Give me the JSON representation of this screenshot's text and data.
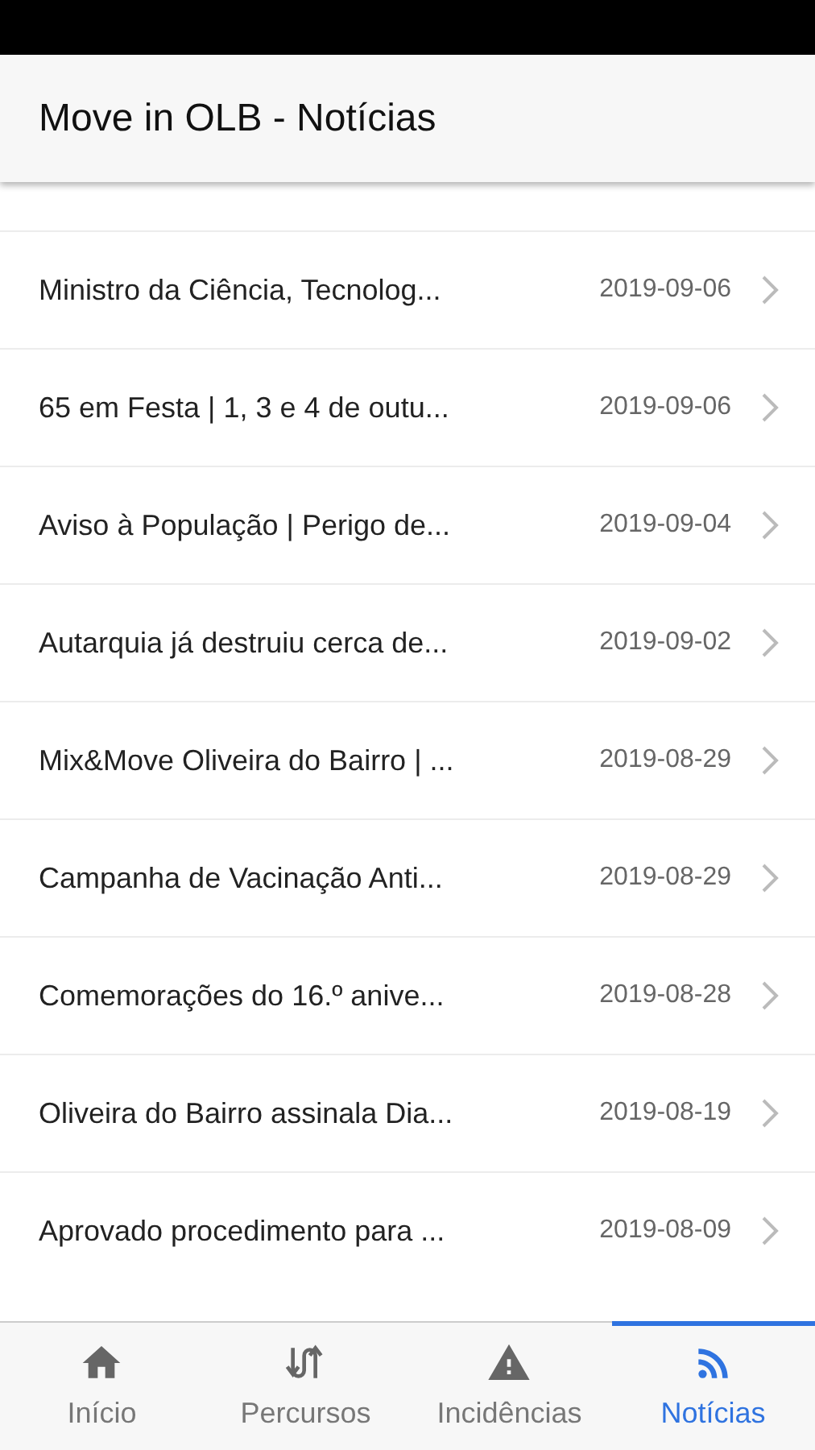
{
  "header": {
    "title": "Move in OLB - Notícias"
  },
  "news": [
    {
      "title": "Ministro da Ciência, Tecnolog...",
      "date": "2019-09-06"
    },
    {
      "title": "65 em Festa | 1, 3 e 4 de outu...",
      "date": "2019-09-06"
    },
    {
      "title": "Aviso à População | Perigo de...",
      "date": "2019-09-04"
    },
    {
      "title": "Autarquia já destruiu cerca de...",
      "date": "2019-09-02"
    },
    {
      "title": "Mix&Move Oliveira do Bairro | ...",
      "date": "2019-08-29"
    },
    {
      "title": "Campanha de Vacinação Anti...",
      "date": "2019-08-29"
    },
    {
      "title": "Comemorações do 16.º anive...",
      "date": "2019-08-28"
    },
    {
      "title": "Oliveira do Bairro assinala Dia...",
      "date": "2019-08-19"
    },
    {
      "title": "Aprovado procedimento para ...",
      "date": "2019-08-09"
    }
  ],
  "tabs": [
    {
      "kind": "home",
      "label": "Início",
      "selected": false
    },
    {
      "kind": "routes",
      "label": "Percursos",
      "selected": false
    },
    {
      "kind": "warning",
      "label": "Incidências",
      "selected": false
    },
    {
      "kind": "rss",
      "label": "Notícias",
      "selected": true
    }
  ]
}
